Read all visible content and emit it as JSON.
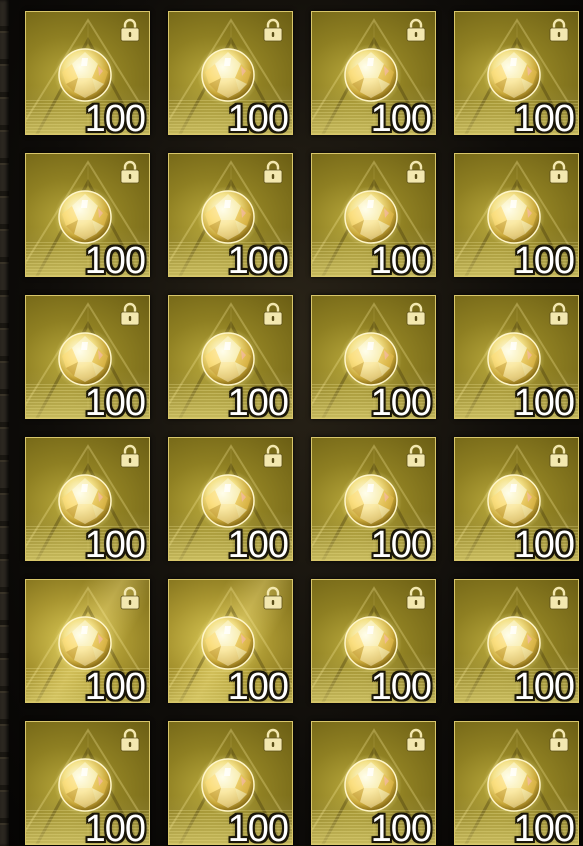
{
  "inventory": {
    "items": [
      {
        "count": "100",
        "icon": "crystal-orb-icon",
        "locked": true,
        "highlight": false
      },
      {
        "count": "100",
        "icon": "crystal-orb-icon",
        "locked": true,
        "highlight": false
      },
      {
        "count": "100",
        "icon": "crystal-orb-icon",
        "locked": true,
        "highlight": false
      },
      {
        "count": "100",
        "icon": "crystal-orb-icon",
        "locked": true,
        "highlight": false
      },
      {
        "count": "100",
        "icon": "crystal-orb-icon",
        "locked": true,
        "highlight": false
      },
      {
        "count": "100",
        "icon": "crystal-orb-icon",
        "locked": true,
        "highlight": false
      },
      {
        "count": "100",
        "icon": "crystal-orb-icon",
        "locked": true,
        "highlight": false
      },
      {
        "count": "100",
        "icon": "crystal-orb-icon",
        "locked": true,
        "highlight": false
      },
      {
        "count": "100",
        "icon": "crystal-orb-icon",
        "locked": true,
        "highlight": false
      },
      {
        "count": "100",
        "icon": "crystal-orb-icon",
        "locked": true,
        "highlight": false
      },
      {
        "count": "100",
        "icon": "crystal-orb-icon",
        "locked": true,
        "highlight": false
      },
      {
        "count": "100",
        "icon": "crystal-orb-icon",
        "locked": true,
        "highlight": false
      },
      {
        "count": "100",
        "icon": "crystal-orb-icon",
        "locked": true,
        "highlight": false
      },
      {
        "count": "100",
        "icon": "crystal-orb-icon",
        "locked": true,
        "highlight": false
      },
      {
        "count": "100",
        "icon": "crystal-orb-icon",
        "locked": true,
        "highlight": false
      },
      {
        "count": "100",
        "icon": "crystal-orb-icon",
        "locked": true,
        "highlight": false
      },
      {
        "count": "100",
        "icon": "crystal-orb-icon",
        "locked": true,
        "highlight": true
      },
      {
        "count": "100",
        "icon": "crystal-orb-icon",
        "locked": true,
        "highlight": true
      },
      {
        "count": "100",
        "icon": "crystal-orb-icon",
        "locked": true,
        "highlight": false
      },
      {
        "count": "100",
        "icon": "crystal-orb-icon",
        "locked": true,
        "highlight": false
      },
      {
        "count": "100",
        "icon": "crystal-orb-icon",
        "locked": true,
        "highlight": false
      },
      {
        "count": "100",
        "icon": "crystal-orb-icon",
        "locked": true,
        "highlight": false
      },
      {
        "count": "100",
        "icon": "crystal-orb-icon",
        "locked": true,
        "highlight": false
      },
      {
        "count": "100",
        "icon": "crystal-orb-icon",
        "locked": true,
        "highlight": false
      }
    ]
  },
  "colors": {
    "tile_border": "#d8c66a",
    "tile_gold": "#8e7f22",
    "count_text": "#ffffff"
  }
}
